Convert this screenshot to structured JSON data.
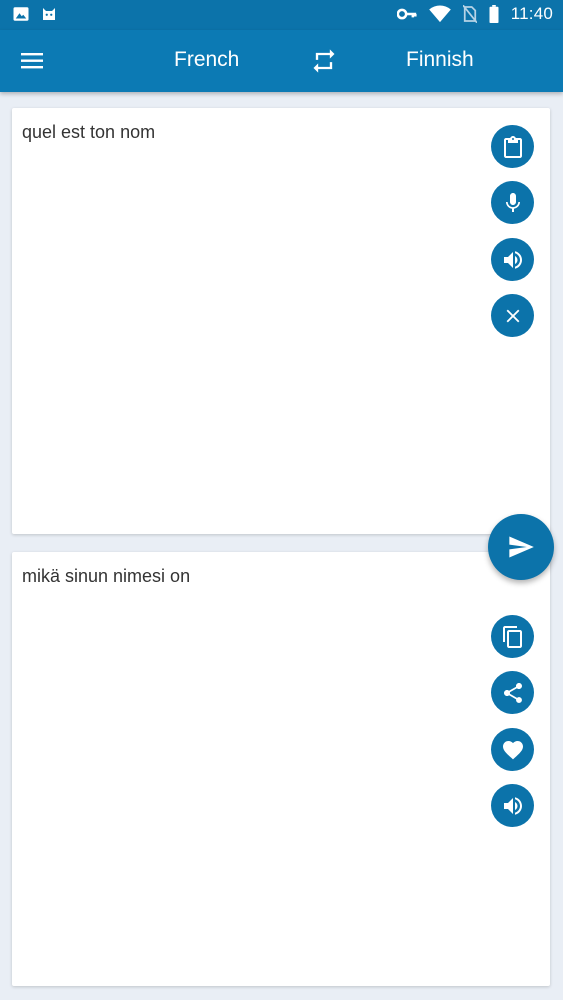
{
  "status_bar": {
    "time": "11:40",
    "left_icons": [
      "image-icon",
      "cat-icon"
    ],
    "right_icons": [
      "key-icon",
      "wifi-icon",
      "no-sim-icon",
      "battery-icon"
    ]
  },
  "toolbar": {
    "source_language": "French",
    "target_language": "Finnish",
    "menu_icon": "menu-icon",
    "swap_icon": "swap-icon"
  },
  "source_panel": {
    "text": "quel est ton nom",
    "actions": [
      "clipboard-icon",
      "mic-icon",
      "speaker-icon",
      "close-icon"
    ]
  },
  "target_panel": {
    "text": "mikä sinun nimesi on",
    "actions": [
      "copy-icon",
      "share-icon",
      "heart-icon",
      "speaker-icon"
    ]
  },
  "fab": {
    "icon": "send-icon"
  },
  "colors": {
    "primary": "#0c7ab4",
    "status_bar": "#0c73aa",
    "background": "#e9eef5",
    "card": "#ffffff",
    "text": "#333333"
  }
}
